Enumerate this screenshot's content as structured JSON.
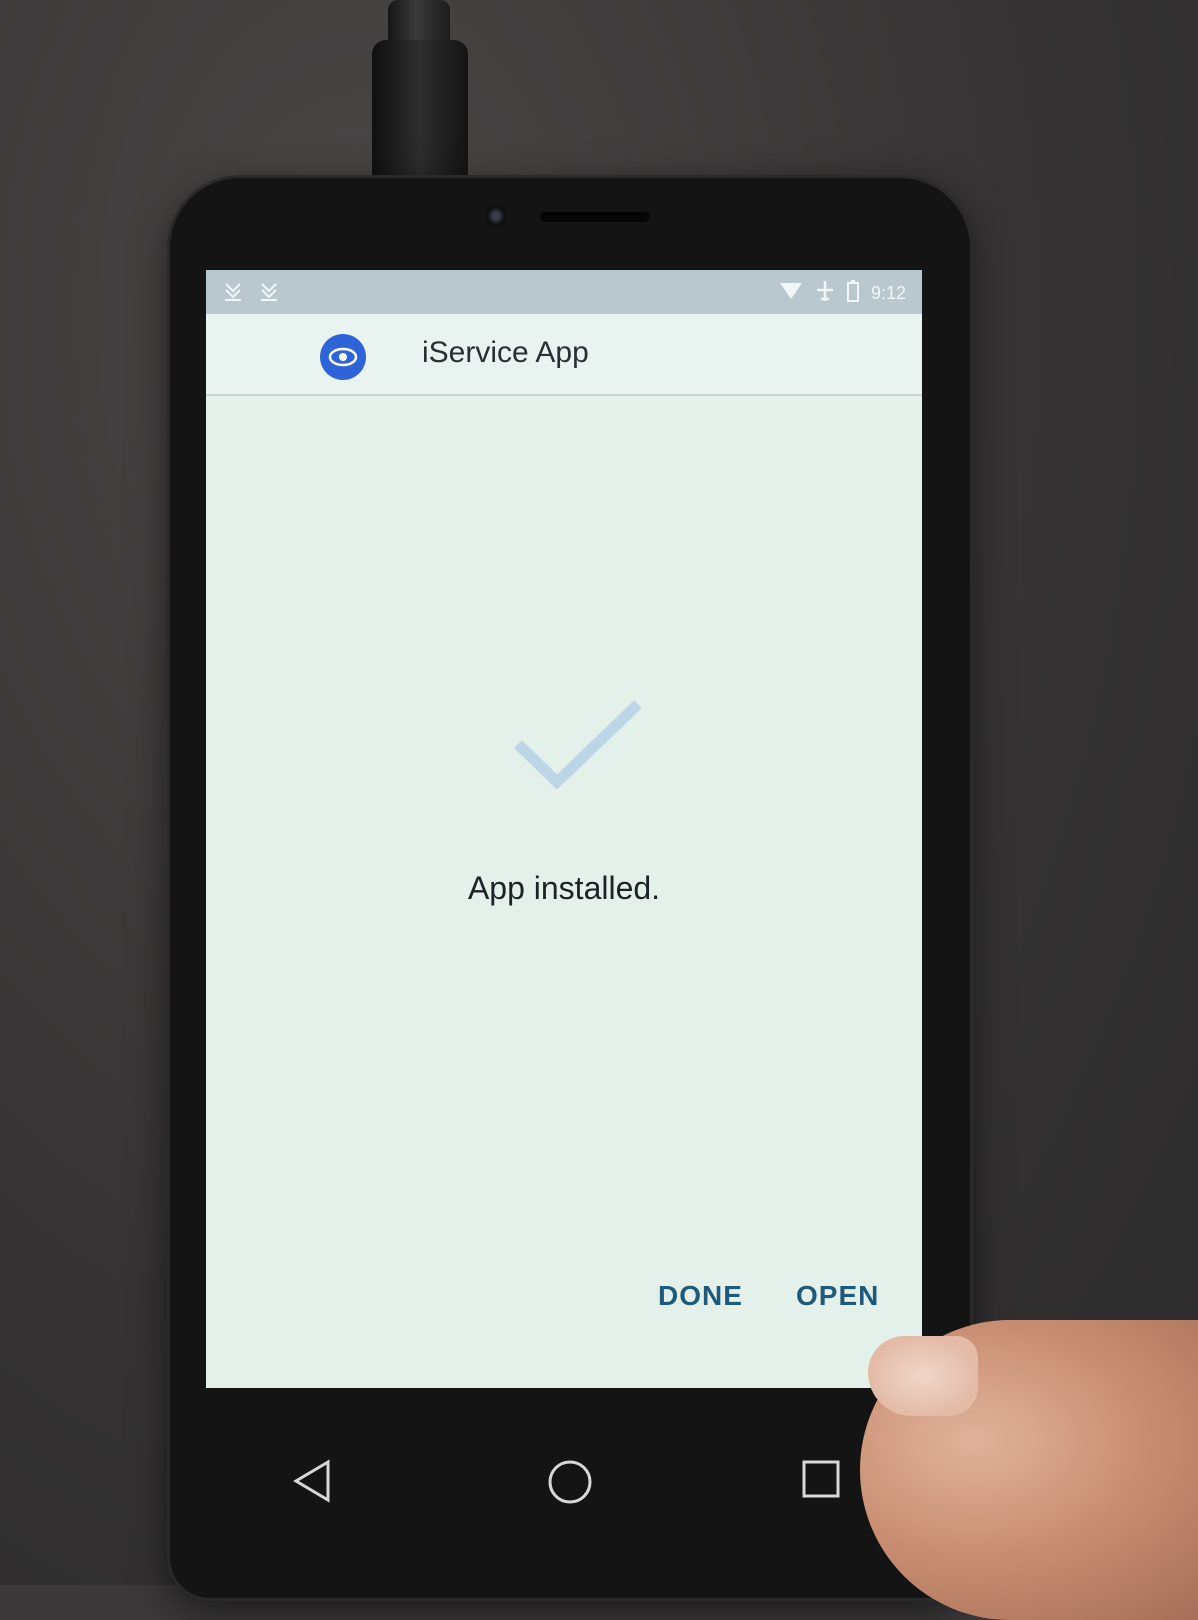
{
  "status_bar": {
    "left_icons": [
      "download-icon",
      "download-icon"
    ],
    "time": "9:12"
  },
  "app_bar": {
    "icon": "eye-icon",
    "title": "iService App"
  },
  "main": {
    "message": "App installed."
  },
  "actions": {
    "done_label": "DONE",
    "open_label": "OPEN"
  },
  "nav": {
    "back": "back-triangle-icon",
    "home": "home-circle-icon",
    "recent": "recents-square-icon"
  },
  "colors": {
    "screen_bg": "#e3f1ea",
    "status_bar": "#b9c8ce",
    "accent_icon": "#2f63d8",
    "button_text": "#1f5a7a",
    "check": "#bcd6e8"
  }
}
